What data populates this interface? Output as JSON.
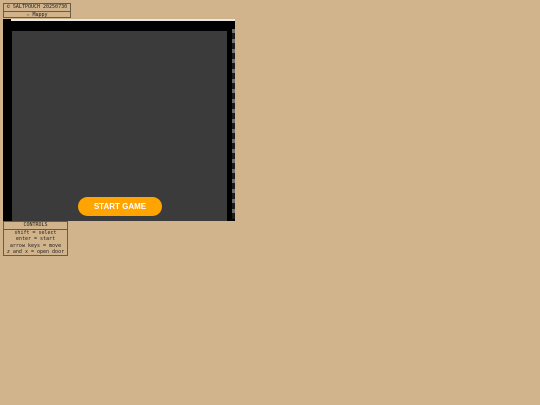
{
  "header": {
    "copyright": "© SALTPOUCH 20250730",
    "brand": "SALTPOUCH",
    "game_title": "☆ Mappy"
  },
  "game": {
    "start_label": "START GAME",
    "button_color": "#ffa400"
  },
  "controls": {
    "heading": "CONTROLS",
    "lines": [
      "shift = select",
      "enter = start",
      "arrow keys = move",
      "z and x = open door"
    ]
  }
}
